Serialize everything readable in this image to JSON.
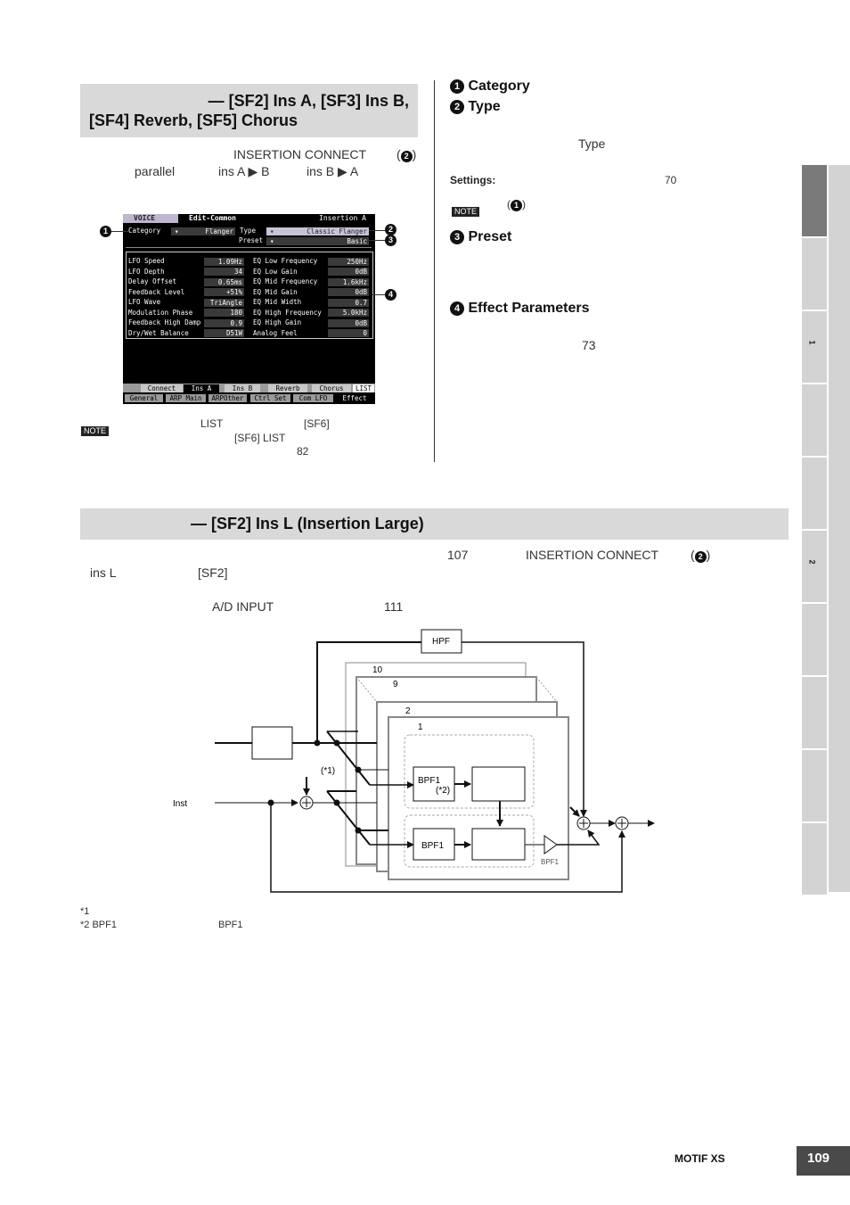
{
  "section1": {
    "header_line1": "— [SF2] Ins A, [SF3] Ins B,",
    "header_line2": "[SF4] Reverb, [SF5] Chorus",
    "intro_term1": "INSERTION CONNECT",
    "intro_ref": "2",
    "intro_opt1": "parallel",
    "intro_opt2": "ins A ▶ B",
    "intro_opt3": "ins B ▶ A",
    "note_badge": "NOTE",
    "note_list": "LIST",
    "note_sf6": "[SF6]",
    "note_sf6list": "[SF6] LIST",
    "note_page": "82"
  },
  "lcd": {
    "mode": "VOICE",
    "screen": "Edit-Common",
    "slot": "Insertion A",
    "category_label": "Category",
    "category_value": "Flanger",
    "type_label": "Type",
    "type_value": "Classic Flanger",
    "preset_label": "Preset",
    "preset_value": "Basic",
    "params_left": [
      {
        "label": "LFO Speed",
        "value": "1.09Hz"
      },
      {
        "label": "LFO Depth",
        "value": "34"
      },
      {
        "label": "Delay Offset",
        "value": "0.65ms"
      },
      {
        "label": "Feedback Level",
        "value": "+51%"
      },
      {
        "label": "LFO Wave",
        "value": "TriAngle"
      },
      {
        "label": "Modulation Phase",
        "value": "180"
      },
      {
        "label": "Feedback High Damp",
        "value": "0.9"
      },
      {
        "label": "Dry/Wet Balance",
        "value": "D51W"
      }
    ],
    "params_right": [
      {
        "label": "EQ Low Frequency",
        "value": "250Hz"
      },
      {
        "label": "EQ Low Gain",
        "value": "0dB"
      },
      {
        "label": "EQ Mid Frequency",
        "value": "1.6kHz"
      },
      {
        "label": "EQ Mid Gain",
        "value": "0dB"
      },
      {
        "label": "EQ Mid Width",
        "value": "0.7"
      },
      {
        "label": "EQ High Frequency",
        "value": "5.0kHz"
      },
      {
        "label": "EQ High Gain",
        "value": "0dB"
      },
      {
        "label": "Analog Feel",
        "value": "0"
      }
    ],
    "tabs_upper": [
      "Connect",
      "Ins A",
      "Ins B",
      "Reverb",
      "Chorus",
      "LIST"
    ],
    "tabs_lower": [
      "General",
      "ARP Main",
      "ARPOther",
      "Ctrl Set",
      "Com LFO",
      "Effect"
    ],
    "callouts": [
      "1",
      "2",
      "3",
      "4"
    ]
  },
  "right_col": {
    "item1_num": "1",
    "item1_title": "Category",
    "item2_num": "2",
    "item2_title": "Type",
    "type_ref": "Type",
    "settings_label": "Settings:",
    "settings_page": "70",
    "note_badge": "NOTE",
    "note_ref": "1",
    "item3_num": "3",
    "item3_title": "Preset",
    "item4_num": "4",
    "item4_title": "Effect Parameters",
    "item4_page": "73"
  },
  "section2": {
    "header": "— [SF2] Ins L (Insertion Large)",
    "p1_page": "107",
    "p1_term": "INSERTION CONNECT",
    "p1_ref": "2",
    "p2_insl": "ins L",
    "p2_sf2": "[SF2]",
    "p3_ad": "A/D INPUT",
    "p3_page": "111"
  },
  "diagram": {
    "hpf": "HPF",
    "layer_labels": [
      "10",
      "9",
      "2",
      "1"
    ],
    "inst_label": "Inst",
    "star1": "(*1)",
    "bpf_upper": "BPF1",
    "bpf_upper_note": "(*2)",
    "bpf_lower": "BPF1",
    "amp_label": "BPF1"
  },
  "footnotes": {
    "f1": "*1",
    "f2a": "*2 BPF1",
    "f2b": "BPF1"
  },
  "side_tabs": {
    "labels": [
      "",
      "",
      "1",
      "",
      "",
      "2",
      "",
      "",
      "",
      ""
    ],
    "active_index": 0
  },
  "footer": {
    "product": "MOTIF XS",
    "page": "109"
  }
}
